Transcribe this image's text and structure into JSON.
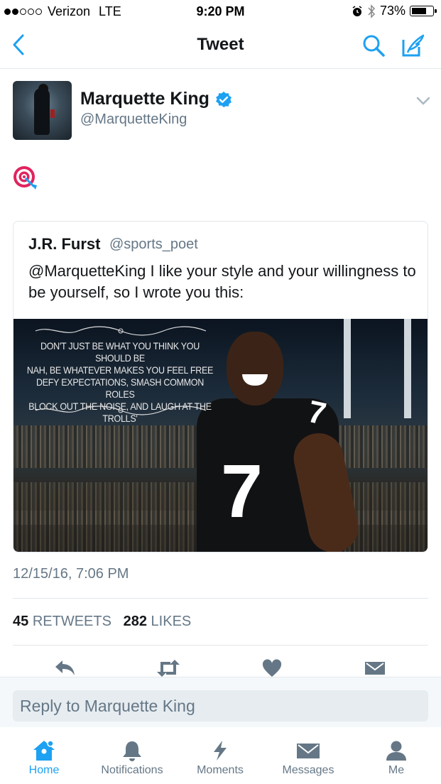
{
  "status_bar": {
    "carrier": "Verizon",
    "network": "LTE",
    "time": "9:20 PM",
    "battery": "73%",
    "battery_level": 0.73
  },
  "nav": {
    "title": "Tweet",
    "back_icon": "chevron-left-icon",
    "search_icon": "search-icon",
    "compose_icon": "compose-icon"
  },
  "tweet": {
    "author_name": "Marquette King",
    "author_handle": "@MarquetteKing",
    "verified": true,
    "body_emoji": "direct-hit-emoji",
    "timestamp": "12/15/16, 7:06 PM",
    "retweets_count": "45",
    "retweets_label": "RETWEETS",
    "likes_count": "282",
    "likes_label": "LIKES"
  },
  "quoted_tweet": {
    "author_name": "J.R. Furst",
    "author_handle": "@sports_poet",
    "text": "@MarquetteKing I like your style and your willingness to be yourself, so I wrote you this:",
    "image_poem": [
      "DON'T JUST BE WHAT YOU THINK YOU SHOULD BE",
      "NAH, BE WHATEVER MAKES YOU FEEL FREE",
      "DEFY EXPECTATIONS, SMASH COMMON ROLES",
      "BLOCK OUT THE NOISE, AND LAUGH AT THE TROLLS'"
    ]
  },
  "actions": [
    "reply-icon",
    "retweet-icon",
    "like-icon",
    "direct-message-icon"
  ],
  "reply": {
    "placeholder": "Reply to Marquette King"
  },
  "tabs": [
    {
      "label": "Home",
      "icon": "home-icon",
      "active": true
    },
    {
      "label": "Notifications",
      "icon": "bell-icon",
      "active": false
    },
    {
      "label": "Moments",
      "icon": "lightning-icon",
      "active": false
    },
    {
      "label": "Messages",
      "icon": "envelope-icon",
      "active": false
    },
    {
      "label": "Me",
      "icon": "person-icon",
      "active": false
    }
  ],
  "colors": {
    "accent": "#1da1f2",
    "secondary_text": "#657786",
    "divider": "#e1e8ed",
    "target_red": "#e0245e"
  }
}
